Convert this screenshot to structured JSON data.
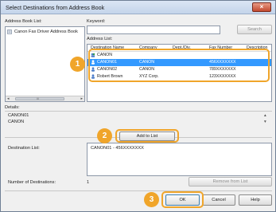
{
  "window": {
    "title": "Select Destinations from Address Book",
    "close_glyph": "×"
  },
  "address_book": {
    "label": "Address Book List:",
    "items": [
      {
        "label": "Canon Fax Driver Address Book"
      }
    ],
    "scroll_left": "◂",
    "scroll_thumb": "III",
    "scroll_right": "▸"
  },
  "keyword": {
    "label": "Keyword:",
    "value": "",
    "search_button": "Search"
  },
  "address_list": {
    "label": "Address List:",
    "columns": [
      "Destination Name",
      "Company",
      "Dept./Div.",
      "Fax Number",
      "Description"
    ],
    "rows": [
      {
        "name": "CANON",
        "company": "",
        "dept": "",
        "fax": "",
        "description": "",
        "icon": "group-icon",
        "selected": false
      },
      {
        "name": "CANON01",
        "company": "CANON",
        "dept": "",
        "fax": "456XXXXXXX",
        "description": "",
        "icon": "person-icon",
        "selected": true
      },
      {
        "name": "CANON02",
        "company": "CANON",
        "dept": "",
        "fax": "789XXXXXXX",
        "description": "",
        "icon": "person-icon",
        "selected": false
      },
      {
        "name": "Robert Brown",
        "company": "XYZ Corp.",
        "dept": "",
        "fax": "123XXXXXXX",
        "description": "",
        "icon": "person-icon",
        "selected": false
      }
    ]
  },
  "details": {
    "label": "Details:",
    "lines": [
      "CANON01",
      "CANON"
    ]
  },
  "add_button": "Add to List",
  "destination_list": {
    "label": "Destination List:",
    "items": [
      "CANON01 - 456XXXXXXX"
    ]
  },
  "number_of_destinations": {
    "label": "Number of Destinations:",
    "value": "1"
  },
  "remove_button": "Remove from List",
  "ok_button": "OK",
  "cancel_button": "Cancel",
  "help_button": "Help",
  "callouts": [
    "1",
    "2",
    "3"
  ],
  "colors": {
    "highlight": "#f0a52a",
    "selection": "#3399ff"
  }
}
